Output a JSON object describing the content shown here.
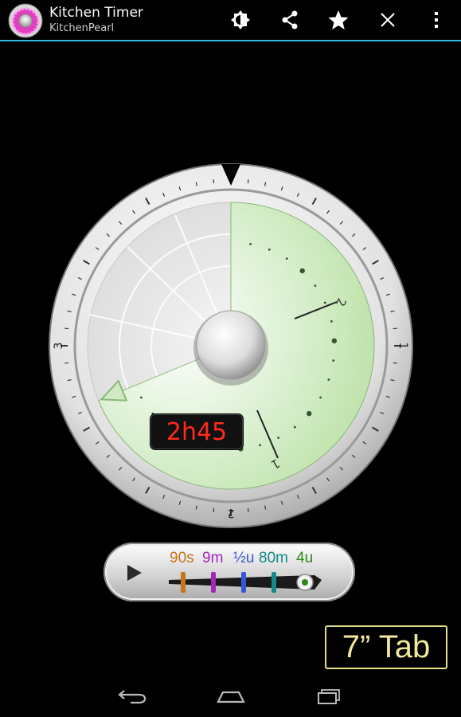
{
  "app": {
    "title": "Kitchen Timer",
    "subtitle": "KitchenPearl",
    "accent": "#33b5e5"
  },
  "actions": {
    "items": [
      {
        "icon": "brightness-icon"
      },
      {
        "icon": "share-icon"
      },
      {
        "icon": "star-icon"
      },
      {
        "icon": "close-icon"
      },
      {
        "icon": "overflow-menu-icon"
      }
    ]
  },
  "dial": {
    "readout": "2h45",
    "readout_color": "#ff2a1a",
    "set_fraction": 0.6875,
    "numbers": [
      "1",
      "2",
      "3"
    ],
    "inner_numbers": [
      "1",
      "2"
    ],
    "fill_color": "#bfe4b2"
  },
  "presets": {
    "items": [
      {
        "label": "90s",
        "color": "#c8741a"
      },
      {
        "label": "9m",
        "color": "#a326b8"
      },
      {
        "label": "½u",
        "color": "#3a56d8"
      },
      {
        "label": "80m",
        "color": "#138a8a"
      },
      {
        "label": "4u",
        "color": "#2e8a1a"
      }
    ],
    "selected_index": 4
  },
  "badge": {
    "label": "7” Tab"
  },
  "nav": {
    "items": [
      {
        "icon": "back-icon"
      },
      {
        "icon": "home-icon"
      },
      {
        "icon": "recent-apps-icon"
      }
    ]
  }
}
